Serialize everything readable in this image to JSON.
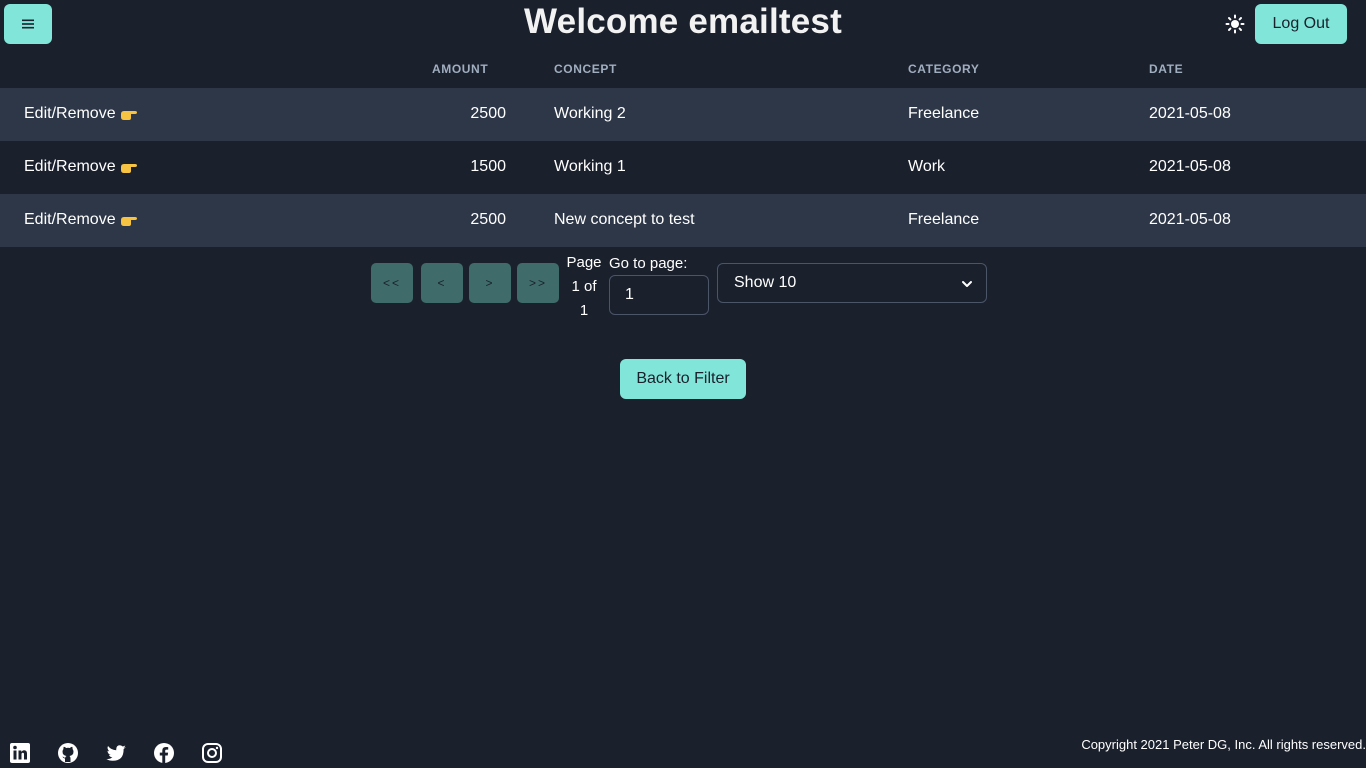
{
  "header": {
    "title": "Welcome emailtest",
    "logout_label": "Log Out"
  },
  "table": {
    "columns": [
      "AMOUNT",
      "CONCEPT",
      "CATEGORY",
      "DATE"
    ],
    "rows": [
      {
        "action": "Edit/Remove",
        "amount": "2500",
        "concept": "Working 2",
        "category": "Freelance",
        "date": "2021-05-08"
      },
      {
        "action": "Edit/Remove",
        "amount": "1500",
        "concept": "Working 1",
        "category": "Work",
        "date": "2021-05-08"
      },
      {
        "action": "Edit/Remove",
        "amount": "2500",
        "concept": "New concept to test",
        "category": "Freelance",
        "date": "2021-05-08"
      }
    ]
  },
  "pagination": {
    "first_label": "<<",
    "prev_label": "<",
    "next_label": ">",
    "last_label": ">>",
    "page_word": "Page",
    "current_of": "1 of",
    "total": "1",
    "goto_label": "Go to page:",
    "goto_value": "1",
    "show_label": "Show 10"
  },
  "actions": {
    "back_label": "Back to Filter"
  },
  "footer": {
    "copyright": "Copyright 2021 Peter DG, Inc. All rights reserved.",
    "icons": [
      "linkedin-icon",
      "github-icon",
      "twitter-icon",
      "facebook-icon",
      "instagram-icon"
    ]
  },
  "colors": {
    "background": "#1a202c",
    "accent": "#81e6d9",
    "row_stripe": "#2d3748",
    "pager_button": "#3f6b6b"
  }
}
